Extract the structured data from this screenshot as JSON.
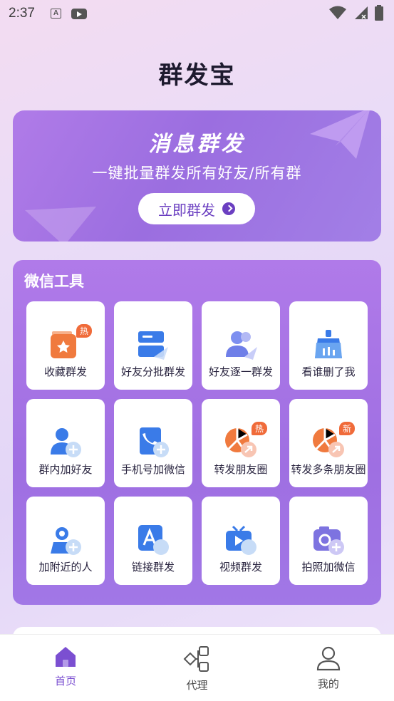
{
  "status_bar": {
    "time": "2:37",
    "icon_a_text": "A"
  },
  "app": {
    "title": "群发宝"
  },
  "banner": {
    "title": "消息群发",
    "subtitle": "一键批量群发所有好友/所有群",
    "button_label": "立即群发"
  },
  "tools": {
    "title": "微信工具",
    "items": [
      {
        "label": "收藏群发",
        "icon": "collect-star-icon",
        "badge": "热"
      },
      {
        "label": "好友分批群发",
        "icon": "batch-message-icon",
        "badge": ""
      },
      {
        "label": "好友逐一群发",
        "icon": "friends-one-by-one-icon",
        "badge": ""
      },
      {
        "label": "看谁删了我",
        "icon": "broom-check-icon",
        "badge": ""
      },
      {
        "label": "群内加好友",
        "icon": "add-group-friend-icon",
        "badge": ""
      },
      {
        "label": "手机号加微信",
        "icon": "phone-add-icon",
        "badge": ""
      },
      {
        "label": "转发朋友圈",
        "icon": "forward-moments-icon",
        "badge": "热"
      },
      {
        "label": "转发多条朋友圈",
        "icon": "forward-multi-moments-icon",
        "badge": "新"
      },
      {
        "label": "加附近的人",
        "icon": "nearby-people-icon",
        "badge": ""
      },
      {
        "label": "链接群发",
        "icon": "link-broadcast-icon",
        "badge": ""
      },
      {
        "label": "视频群发",
        "icon": "video-broadcast-icon",
        "badge": ""
      },
      {
        "label": "拍照加微信",
        "icon": "camera-add-icon",
        "badge": ""
      }
    ]
  },
  "nav": {
    "items": [
      {
        "label": "首页",
        "icon": "home-icon",
        "active": true
      },
      {
        "label": "代理",
        "icon": "agent-network-icon",
        "active": false
      },
      {
        "label": "我的",
        "icon": "profile-icon",
        "active": false
      }
    ]
  },
  "colors": {
    "accent": "#7b4fd1",
    "hot_badge": "#f06b3a",
    "icon_blue": "#3a7be8",
    "icon_orange": "#f07a3e"
  }
}
